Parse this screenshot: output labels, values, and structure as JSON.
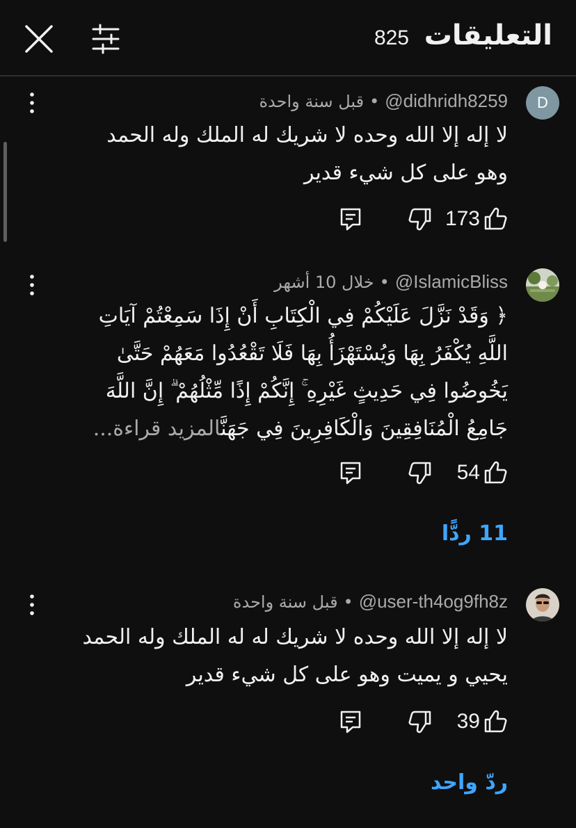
{
  "header": {
    "title": "التعليقات",
    "count": "825"
  },
  "comments": [
    {
      "avatar_letter": "D",
      "handle": "@didhridh8259",
      "time": "قبل سنة واحدة",
      "text_lines": [
        "لا إله إلا الله وحده لا شريك له الملك وله الحمد",
        "وهو على كل شيء قدير"
      ],
      "likes": "173",
      "replies": ""
    },
    {
      "avatar_letter": "",
      "handle": "@IslamicBliss",
      "time": "خلال 10 أشهر",
      "text_lines": [
        "﴿ وَقَدْ نَزَّلَ عَلَيْكُمْ فِي الْكِتَابِ أَنْ إِذَا سَمِعْتُمْ آيَاتِ",
        "اللَّهِ يُكْفَرُ بِهَا وَيُسْتَهْزَأُ بِهَا فَلَا تَقْعُدُوا مَعَهُمْ حَتَّىٰ",
        "يَخُوضُوا فِي حَدِيثٍ غَيْرِهِ ۚ إِنَّكُمْ إِذًا مِّثْلُهُمْ ۗ إِنَّ اللَّهَ",
        "جَامِعُ الْمُنَافِقِينَ وَالْكَافِرِينَ فِي جَهَنَّ"
      ],
      "read_more": "المزيد قراءة...",
      "likes": "54",
      "replies": "11 ردًّا"
    },
    {
      "avatar_letter": "",
      "handle": "@user-th4og9fh8z",
      "time": "قبل سنة واحدة",
      "text_lines": [
        "لا إله إلا الله وحده لا شريك له له الملك وله الحمد",
        "يحيي و يميت وهو على كل شيء قدير"
      ],
      "likes": "39",
      "replies": "ردّ واحد"
    }
  ],
  "colors": {
    "background": "#0f0f0f",
    "text": "#f1f1f1",
    "secondary_text": "#aaaaaa",
    "link": "#3ea6ff",
    "divider": "#303030"
  },
  "icons": {
    "close": "close-icon",
    "filter": "tune-icon",
    "more": "more-vert-icon",
    "like": "thumb-up-icon",
    "dislike": "thumb-down-icon",
    "reply": "comment-icon"
  }
}
